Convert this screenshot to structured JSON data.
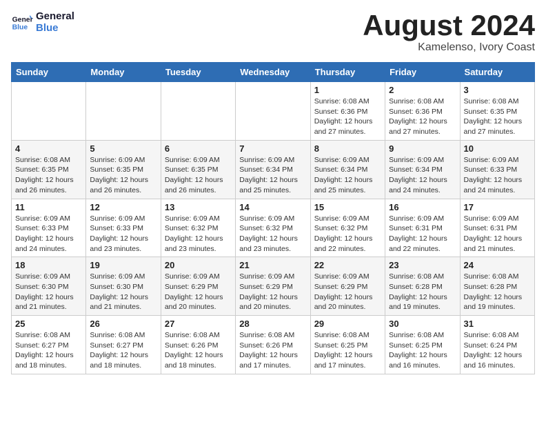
{
  "logo": {
    "line1": "General",
    "line2": "Blue"
  },
  "title": "August 2024",
  "subtitle": "Kamelenso, Ivory Coast",
  "weekdays": [
    "Sunday",
    "Monday",
    "Tuesday",
    "Wednesday",
    "Thursday",
    "Friday",
    "Saturday"
  ],
  "weeks": [
    [
      {
        "day": "",
        "info": ""
      },
      {
        "day": "",
        "info": ""
      },
      {
        "day": "",
        "info": ""
      },
      {
        "day": "",
        "info": ""
      },
      {
        "day": "1",
        "info": "Sunrise: 6:08 AM\nSunset: 6:36 PM\nDaylight: 12 hours\nand 27 minutes."
      },
      {
        "day": "2",
        "info": "Sunrise: 6:08 AM\nSunset: 6:36 PM\nDaylight: 12 hours\nand 27 minutes."
      },
      {
        "day": "3",
        "info": "Sunrise: 6:08 AM\nSunset: 6:35 PM\nDaylight: 12 hours\nand 27 minutes."
      }
    ],
    [
      {
        "day": "4",
        "info": "Sunrise: 6:08 AM\nSunset: 6:35 PM\nDaylight: 12 hours\nand 26 minutes."
      },
      {
        "day": "5",
        "info": "Sunrise: 6:09 AM\nSunset: 6:35 PM\nDaylight: 12 hours\nand 26 minutes."
      },
      {
        "day": "6",
        "info": "Sunrise: 6:09 AM\nSunset: 6:35 PM\nDaylight: 12 hours\nand 26 minutes."
      },
      {
        "day": "7",
        "info": "Sunrise: 6:09 AM\nSunset: 6:34 PM\nDaylight: 12 hours\nand 25 minutes."
      },
      {
        "day": "8",
        "info": "Sunrise: 6:09 AM\nSunset: 6:34 PM\nDaylight: 12 hours\nand 25 minutes."
      },
      {
        "day": "9",
        "info": "Sunrise: 6:09 AM\nSunset: 6:34 PM\nDaylight: 12 hours\nand 24 minutes."
      },
      {
        "day": "10",
        "info": "Sunrise: 6:09 AM\nSunset: 6:33 PM\nDaylight: 12 hours\nand 24 minutes."
      }
    ],
    [
      {
        "day": "11",
        "info": "Sunrise: 6:09 AM\nSunset: 6:33 PM\nDaylight: 12 hours\nand 24 minutes."
      },
      {
        "day": "12",
        "info": "Sunrise: 6:09 AM\nSunset: 6:33 PM\nDaylight: 12 hours\nand 23 minutes."
      },
      {
        "day": "13",
        "info": "Sunrise: 6:09 AM\nSunset: 6:32 PM\nDaylight: 12 hours\nand 23 minutes."
      },
      {
        "day": "14",
        "info": "Sunrise: 6:09 AM\nSunset: 6:32 PM\nDaylight: 12 hours\nand 23 minutes."
      },
      {
        "day": "15",
        "info": "Sunrise: 6:09 AM\nSunset: 6:32 PM\nDaylight: 12 hours\nand 22 minutes."
      },
      {
        "day": "16",
        "info": "Sunrise: 6:09 AM\nSunset: 6:31 PM\nDaylight: 12 hours\nand 22 minutes."
      },
      {
        "day": "17",
        "info": "Sunrise: 6:09 AM\nSunset: 6:31 PM\nDaylight: 12 hours\nand 21 minutes."
      }
    ],
    [
      {
        "day": "18",
        "info": "Sunrise: 6:09 AM\nSunset: 6:30 PM\nDaylight: 12 hours\nand 21 minutes."
      },
      {
        "day": "19",
        "info": "Sunrise: 6:09 AM\nSunset: 6:30 PM\nDaylight: 12 hours\nand 21 minutes."
      },
      {
        "day": "20",
        "info": "Sunrise: 6:09 AM\nSunset: 6:29 PM\nDaylight: 12 hours\nand 20 minutes."
      },
      {
        "day": "21",
        "info": "Sunrise: 6:09 AM\nSunset: 6:29 PM\nDaylight: 12 hours\nand 20 minutes."
      },
      {
        "day": "22",
        "info": "Sunrise: 6:09 AM\nSunset: 6:29 PM\nDaylight: 12 hours\nand 20 minutes."
      },
      {
        "day": "23",
        "info": "Sunrise: 6:08 AM\nSunset: 6:28 PM\nDaylight: 12 hours\nand 19 minutes."
      },
      {
        "day": "24",
        "info": "Sunrise: 6:08 AM\nSunset: 6:28 PM\nDaylight: 12 hours\nand 19 minutes."
      }
    ],
    [
      {
        "day": "25",
        "info": "Sunrise: 6:08 AM\nSunset: 6:27 PM\nDaylight: 12 hours\nand 18 minutes."
      },
      {
        "day": "26",
        "info": "Sunrise: 6:08 AM\nSunset: 6:27 PM\nDaylight: 12 hours\nand 18 minutes."
      },
      {
        "day": "27",
        "info": "Sunrise: 6:08 AM\nSunset: 6:26 PM\nDaylight: 12 hours\nand 18 minutes."
      },
      {
        "day": "28",
        "info": "Sunrise: 6:08 AM\nSunset: 6:26 PM\nDaylight: 12 hours\nand 17 minutes."
      },
      {
        "day": "29",
        "info": "Sunrise: 6:08 AM\nSunset: 6:25 PM\nDaylight: 12 hours\nand 17 minutes."
      },
      {
        "day": "30",
        "info": "Sunrise: 6:08 AM\nSunset: 6:25 PM\nDaylight: 12 hours\nand 16 minutes."
      },
      {
        "day": "31",
        "info": "Sunrise: 6:08 AM\nSunset: 6:24 PM\nDaylight: 12 hours\nand 16 minutes."
      }
    ]
  ]
}
